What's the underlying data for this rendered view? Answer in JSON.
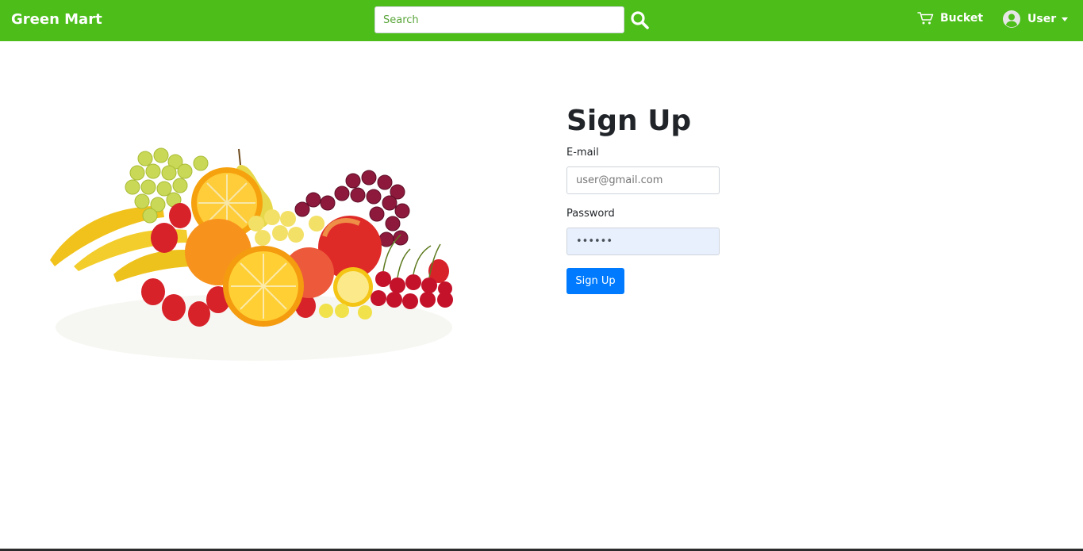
{
  "brand": {
    "name": "Green Mart"
  },
  "search": {
    "placeholder": "Search",
    "icon": "search-icon"
  },
  "nav": {
    "bucket_label": "Bucket",
    "user_label": "User"
  },
  "form": {
    "title": "Sign Up",
    "email_label": "E-mail",
    "email_placeholder": "user@gmail.com",
    "password_label": "Password",
    "password_value": "••••••",
    "submit_label": "Sign Up"
  },
  "colors": {
    "navbar": "#4cbd19",
    "primary_button": "#007bff",
    "autofill_bg": "#e8f0fe"
  },
  "hero_image": "fruit-assortment-image"
}
